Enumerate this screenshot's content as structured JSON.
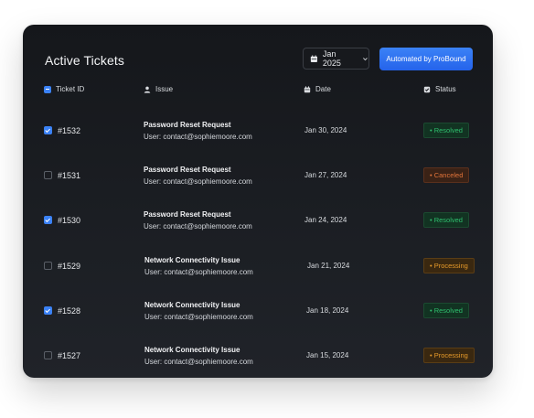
{
  "title": "Active Tickets",
  "date_filter": {
    "label": "Jan 2025",
    "icon": "calendar-icon"
  },
  "automated_button": "Automated by ProBound",
  "columns": {
    "ticket_id": "Ticket ID",
    "issue": "Issue",
    "date": "Date",
    "status": "Status"
  },
  "tickets": [
    {
      "id": "#1532",
      "checked": true,
      "issue": "Password Reset Request",
      "user": "User: contact@sophiemoore.com",
      "date": "Jan 30, 2024",
      "status": "• Resolved",
      "status_type": "resolved"
    },
    {
      "id": "#1531",
      "checked": false,
      "issue": "Password Reset Request",
      "user": "User: contact@sophiemoore.com",
      "date": "Jan 27, 2024",
      "status": "• Canceled",
      "status_type": "canceled"
    },
    {
      "id": "#1530",
      "checked": true,
      "issue": "Password Reset Request",
      "user": "User: contact@sophiemoore.com",
      "date": "Jan 24, 2024",
      "status": "• Resolved",
      "status_type": "resolved"
    },
    {
      "id": "#1529",
      "checked": false,
      "issue": "Network Connectivity Issue",
      "user": "User: contact@sophiemoore.com",
      "date": "Jan 21, 2024",
      "status": "• Processing",
      "status_type": "processing"
    },
    {
      "id": "#1528",
      "checked": true,
      "issue": "Network Connectivity Issue",
      "user": "User: contact@sophiemoore.com",
      "date": "Jan 18, 2024",
      "status": "• Resolved",
      "status_type": "resolved"
    },
    {
      "id": "#1527",
      "checked": false,
      "issue": "Network Connectivity Issue",
      "user": "User: contact@sophiemoore.com",
      "date": "Jan 15, 2024",
      "status": "• Processing",
      "status_type": "processing"
    }
  ],
  "colors": {
    "accent": "#3b82f6",
    "resolved": "#2fbf6e",
    "canceled": "#e2743a",
    "processing": "#e69a2a",
    "card_bg": "#17191d"
  }
}
